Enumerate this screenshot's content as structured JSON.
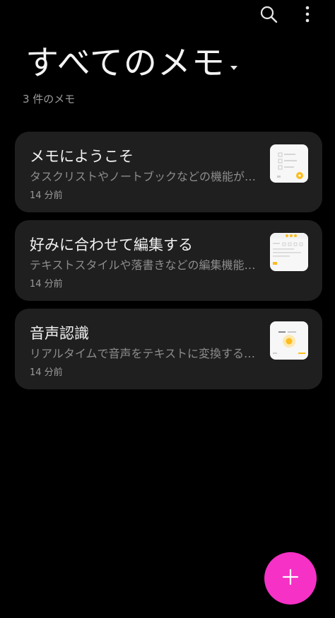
{
  "header": {
    "title": "すべてのメモ",
    "count_label": "3 件のメモ"
  },
  "icons": {
    "search": "search-icon",
    "more": "more-vertical-icon",
    "title_dropdown": "caret-down-icon",
    "add": "plus-icon"
  },
  "colors": {
    "background": "#000000",
    "card": "#1f1f1f",
    "fab": "#f531c6",
    "thumb_accent": "#fdbc21"
  },
  "notes": [
    {
      "title": "メモにようこそ",
      "snippet": "タスクリストやノートブックなどの機能が…",
      "time": "14 分前"
    },
    {
      "title": "好みに合わせて編集する",
      "snippet": "テキストスタイルや落書きなどの編集機能…",
      "time": "14 分前"
    },
    {
      "title": "音声認識",
      "snippet": "リアルタイムで音声をテキストに変換する…",
      "time": "14 分前"
    }
  ]
}
